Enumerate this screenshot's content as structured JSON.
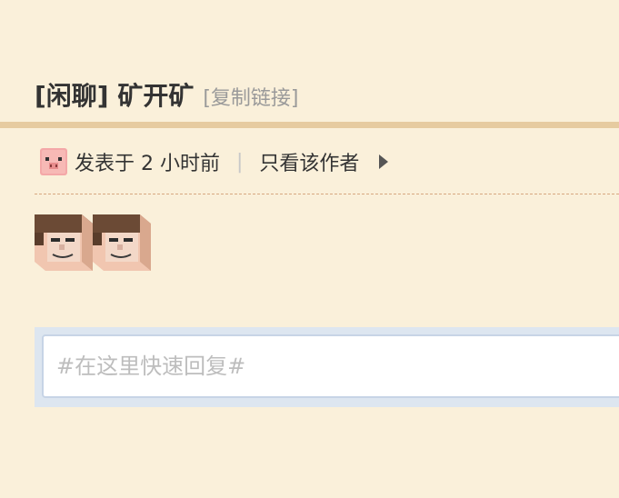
{
  "post": {
    "title": "[闲聊] 矿开矿",
    "copy_link": "[复制链接]",
    "author_avatar_icon": "pig-face-icon",
    "posted_time": "发表于 2 小时前",
    "separator": "|",
    "only_author": "只看该作者",
    "more_icon": "play-triangle-icon",
    "emotes": [
      "steve-face-emote",
      "steve-face-emote"
    ]
  },
  "reply": {
    "placeholder": "#在这里快速回复#",
    "value": ""
  },
  "colors": {
    "background": "#faf0da",
    "title_rule": "#e6cba0",
    "dash_rule": "#d6a880",
    "reply_frame": "#dde6f0"
  }
}
